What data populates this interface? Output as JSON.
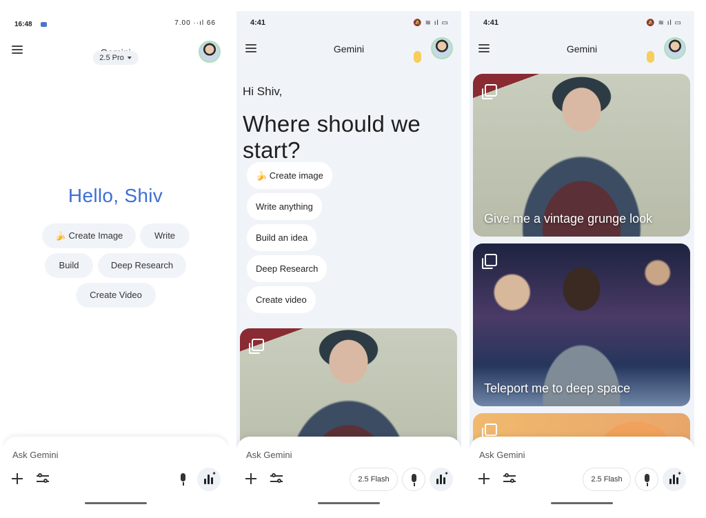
{
  "screen1": {
    "status": {
      "time": "16:48",
      "sys": "7.00 ··ıl 66"
    },
    "app_title": "Gemini",
    "model": "2.5 Pro",
    "greeting": "Hello, Shiv",
    "chips": [
      "🍌 Create Image",
      "Write",
      "Build",
      "Deep Research",
      "Create Video"
    ],
    "composer": {
      "placeholder": "Ask Gemini"
    }
  },
  "screen2": {
    "status": {
      "time": "4:41",
      "sys": "🔕 ≋ ıl ▭"
    },
    "app_title": "Gemini",
    "hi": "Hi Shiv,",
    "headline": "Where should we start?",
    "chips": [
      "🍌 Create image",
      "Write anything",
      "Build an idea",
      "Deep Research",
      "Create video"
    ],
    "composer": {
      "placeholder": "Ask Gemini",
      "model": "2.5 Flash"
    }
  },
  "screen3": {
    "status": {
      "time": "4:41",
      "sys": "🔕 ≋ ıl ▭"
    },
    "app_title": "Gemini",
    "cards": [
      "Give me a vintage grunge look",
      "Teleport me to deep space"
    ],
    "composer": {
      "placeholder": "Ask Gemini",
      "model": "2.5 Flash"
    }
  }
}
